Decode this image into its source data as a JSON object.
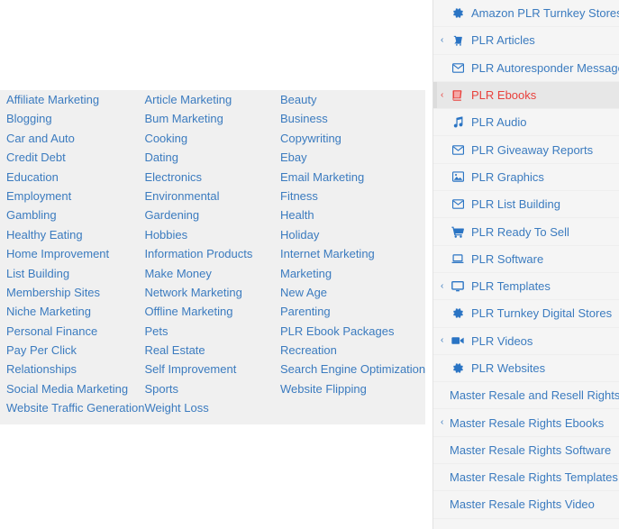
{
  "colors": {
    "link_blue": "#3b7bbf",
    "icon_blue": "#2a74c4",
    "active_red": "#e8413c",
    "panel_bg": "#f0f0f0",
    "sidebar_bg": "#f5f5f5",
    "active_bg": "#e7e7e7"
  },
  "main": {
    "columns": [
      {
        "links": [
          "Affiliate Marketing",
          "Blogging",
          "Car and Auto",
          "Credit Debt",
          "Education",
          "Employment",
          "Gambling",
          "Healthy Eating",
          "Home Improvement",
          "List Building",
          "Membership Sites",
          "Niche Marketing",
          "Personal Finance",
          "Pay Per Click",
          "Relationships",
          "Social Media Marketing",
          "Website Traffic Generation"
        ]
      },
      {
        "links": [
          "Article Marketing",
          "Bum Marketing",
          "Cooking",
          "Dating",
          "Electronics",
          "Environmental",
          "Gardening",
          "Hobbies",
          "Information Products",
          "Make Money",
          "Network Marketing",
          "Offline Marketing",
          "Pets",
          "Real Estate",
          "Self Improvement",
          "Sports",
          "Weight Loss"
        ]
      },
      {
        "links": [
          "Beauty",
          "Business",
          "Copywriting",
          "Ebay",
          "Email Marketing",
          "Fitness",
          "Health",
          "Holiday",
          "Internet Marketing",
          "Marketing",
          "New Age",
          "Parenting",
          "PLR Ebook Packages",
          "Recreation",
          "Search Engine Optimization",
          "Website Flipping"
        ]
      }
    ]
  },
  "sidebar": {
    "items": [
      {
        "label": "Amazon PLR Turnkey Stores",
        "icon": "gear-icon",
        "chevron": false,
        "active": false
      },
      {
        "label": "PLR Articles",
        "icon": "article-icon",
        "chevron": true,
        "active": false
      },
      {
        "label": "PLR Autoresponder Messages",
        "icon": "envelope-icon",
        "chevron": false,
        "active": false
      },
      {
        "label": "PLR Ebooks",
        "icon": "book-icon",
        "chevron": true,
        "active": true
      },
      {
        "label": "PLR Audio",
        "icon": "music-note-icon",
        "chevron": false,
        "active": false
      },
      {
        "label": "PLR Giveaway Reports",
        "icon": "envelope-icon",
        "chevron": false,
        "active": false
      },
      {
        "label": "PLR Graphics",
        "icon": "image-icon",
        "chevron": false,
        "active": false
      },
      {
        "label": "PLR List Building",
        "icon": "envelope-icon",
        "chevron": false,
        "active": false
      },
      {
        "label": "PLR Ready To Sell",
        "icon": "cart-icon",
        "chevron": false,
        "active": false
      },
      {
        "label": "PLR Software",
        "icon": "laptop-icon",
        "chevron": false,
        "active": false
      },
      {
        "label": "PLR Templates",
        "icon": "monitor-icon",
        "chevron": true,
        "active": false
      },
      {
        "label": "PLR Turnkey Digital Stores",
        "icon": "gear-icon",
        "chevron": false,
        "active": false
      },
      {
        "label": "PLR Videos",
        "icon": "video-camera-icon",
        "chevron": true,
        "active": false
      },
      {
        "label": "PLR Websites",
        "icon": "gear-icon",
        "chevron": false,
        "active": false
      },
      {
        "label": "Master Resale and Resell Rights",
        "icon": "none",
        "chevron": false,
        "active": false
      },
      {
        "label": "Master Resale Rights Ebooks",
        "icon": "none",
        "chevron": true,
        "active": false
      },
      {
        "label": "Master Resale Rights Software",
        "icon": "none",
        "chevron": false,
        "active": false
      },
      {
        "label": "Master Resale Rights Templates",
        "icon": "none",
        "chevron": false,
        "active": false
      },
      {
        "label": "Master Resale Rights Video",
        "icon": "none",
        "chevron": false,
        "active": false
      }
    ],
    "chevron_glyph": "‹"
  }
}
